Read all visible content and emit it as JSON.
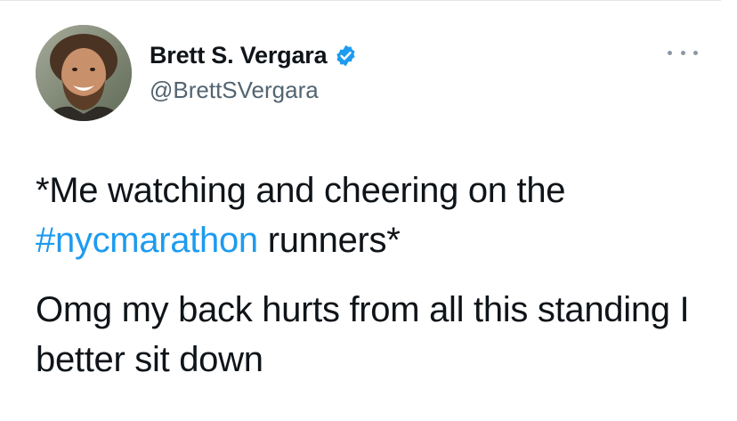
{
  "user": {
    "display_name": "Brett S. Vergara",
    "handle": "@BrettSVergara",
    "verified": true,
    "avatar_icon": "profile-photo"
  },
  "menu": {
    "icon": "more-horizontal-icon"
  },
  "tweet": {
    "line1_prefix": "*Me watching and cheering on the",
    "hashtag": "#nycmarathon",
    "line1_suffix": " runners*",
    "paragraph2": "Omg my back hurts from all this standing I better sit down"
  },
  "colors": {
    "text": "#0f1419",
    "secondary_text": "#536471",
    "link": "#1d9bf0",
    "verified_badge": "#1d9bf0",
    "background": "#ffffff"
  }
}
